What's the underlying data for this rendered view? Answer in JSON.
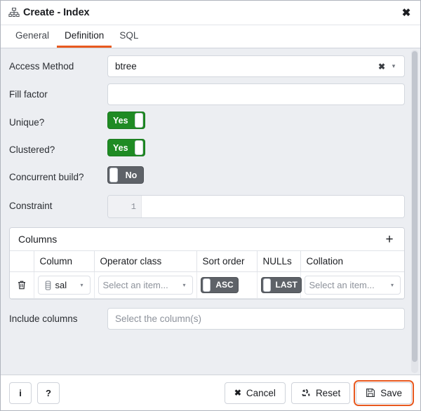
{
  "window": {
    "title": "Create - Index",
    "icon": "index-tree-icon",
    "close_label": "✖"
  },
  "tabs": [
    {
      "label": "General",
      "active": false
    },
    {
      "label": "Definition",
      "active": true
    },
    {
      "label": "SQL",
      "active": false
    }
  ],
  "form": {
    "access_method": {
      "label": "Access Method",
      "value": "btree",
      "clear_label": "✖",
      "caret": "▾"
    },
    "fill_factor": {
      "label": "Fill factor",
      "value": "",
      "placeholder": ""
    },
    "unique": {
      "label": "Unique?",
      "value": "Yes",
      "state": "on"
    },
    "clustered": {
      "label": "Clustered?",
      "value": "Yes",
      "state": "on"
    },
    "concurrent_build": {
      "label": "Concurrent build?",
      "value": "No",
      "state": "off"
    },
    "constraint": {
      "label": "Constraint",
      "line_number": "1",
      "value": ""
    },
    "include_columns": {
      "label": "Include columns",
      "value": "",
      "placeholder": "Select the column(s)"
    }
  },
  "columns_panel": {
    "title": "Columns",
    "add_label": "+",
    "headers": [
      "",
      "Column",
      "Operator class",
      "Sort order",
      "NULLs",
      "Collation"
    ],
    "rows": [
      {
        "delete_icon": "trash-icon",
        "column": "sal",
        "column_icon": "table-column-icon",
        "operator_class": "Select an item...",
        "sort_order": "ASC",
        "sort_order_state": "off",
        "nulls": "LAST",
        "nulls_state": "off",
        "collation": "Select an item...",
        "caret": "▾"
      }
    ]
  },
  "footer": {
    "info_label": "i",
    "help_label": "?",
    "cancel_label": "Cancel",
    "cancel_icon": "✖",
    "reset_label": "Reset",
    "save_label": "Save"
  },
  "colors": {
    "accent_orange": "#e8591f",
    "toggle_on_green": "#1f8b24",
    "toggle_off_gray": "#5e6268",
    "body_bg": "#eceef2"
  }
}
